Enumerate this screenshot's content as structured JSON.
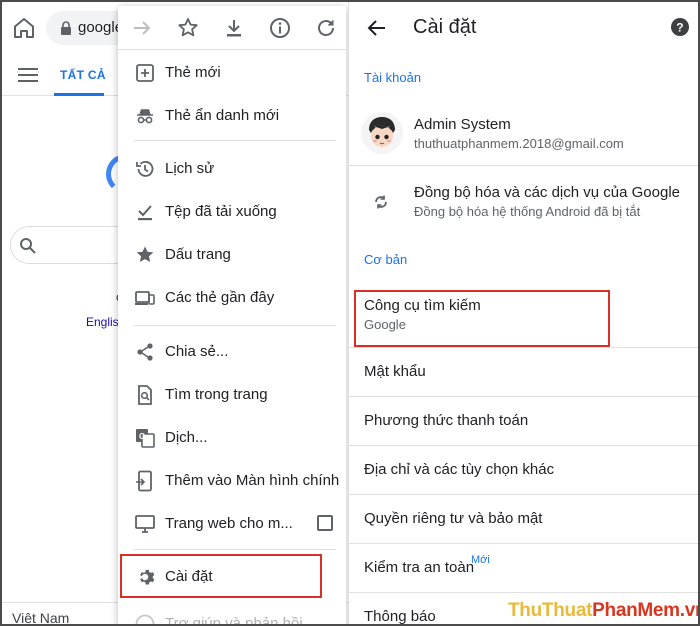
{
  "browser": {
    "url": "google",
    "tab_all": "TẤT CẢ",
    "english_link": "Englis",
    "g_text": "c",
    "country": "Việt Nam"
  },
  "menu": {
    "items": [
      {
        "label": "Thẻ mới",
        "icon": "plus-square-icon"
      },
      {
        "label": "Thẻ ẩn danh mới",
        "icon": "incognito-icon"
      },
      {
        "label": "Lịch sử",
        "icon": "history-icon"
      },
      {
        "label": "Tệp đã tải xuống",
        "icon": "download-check-icon"
      },
      {
        "label": "Dấu trang",
        "icon": "star-icon"
      },
      {
        "label": "Các thẻ gần đây",
        "icon": "devices-icon"
      },
      {
        "label": "Chia sẻ...",
        "icon": "share-icon"
      },
      {
        "label": "Tìm trong trang",
        "icon": "find-in-page-icon"
      },
      {
        "label": "Dịch...",
        "icon": "translate-icon"
      },
      {
        "label": "Thêm vào Màn hình chính",
        "icon": "add-to-home-icon"
      },
      {
        "label": "Trang web cho m...",
        "icon": "desktop-icon"
      },
      {
        "label": "Cài đặt",
        "icon": "gear-icon"
      },
      {
        "label": "Trợ giúp và phản hồi",
        "icon": "help-icon"
      }
    ]
  },
  "settings": {
    "title": "Cài đặt",
    "section_account": "Tài khoản",
    "account_name": "Admin System",
    "account_email": "thuthuatphanmem.2018@gmail.com",
    "sync_title": "Đồng bộ hóa và các dịch vụ của Google",
    "sync_sub": "Đồng bộ hóa hệ thống Android đã bị tắt",
    "section_basic": "Cơ bản",
    "search_engine_title": "Công cụ tìm kiếm",
    "search_engine_value": "Google",
    "rows": [
      "Mật khẩu",
      "Phương thức thanh toán",
      "Địa chỉ và các tùy chọn khác",
      "Quyền riêng tư và bảo mật",
      "Kiểm tra an toàn",
      "Thông báo"
    ],
    "new_badge": "Mới"
  },
  "watermark": {
    "part1": "ThuThuat",
    "part2": "PhanMem",
    "part3": ".vn",
    "color1": "#e8b93a",
    "color2": "#d9361f"
  }
}
